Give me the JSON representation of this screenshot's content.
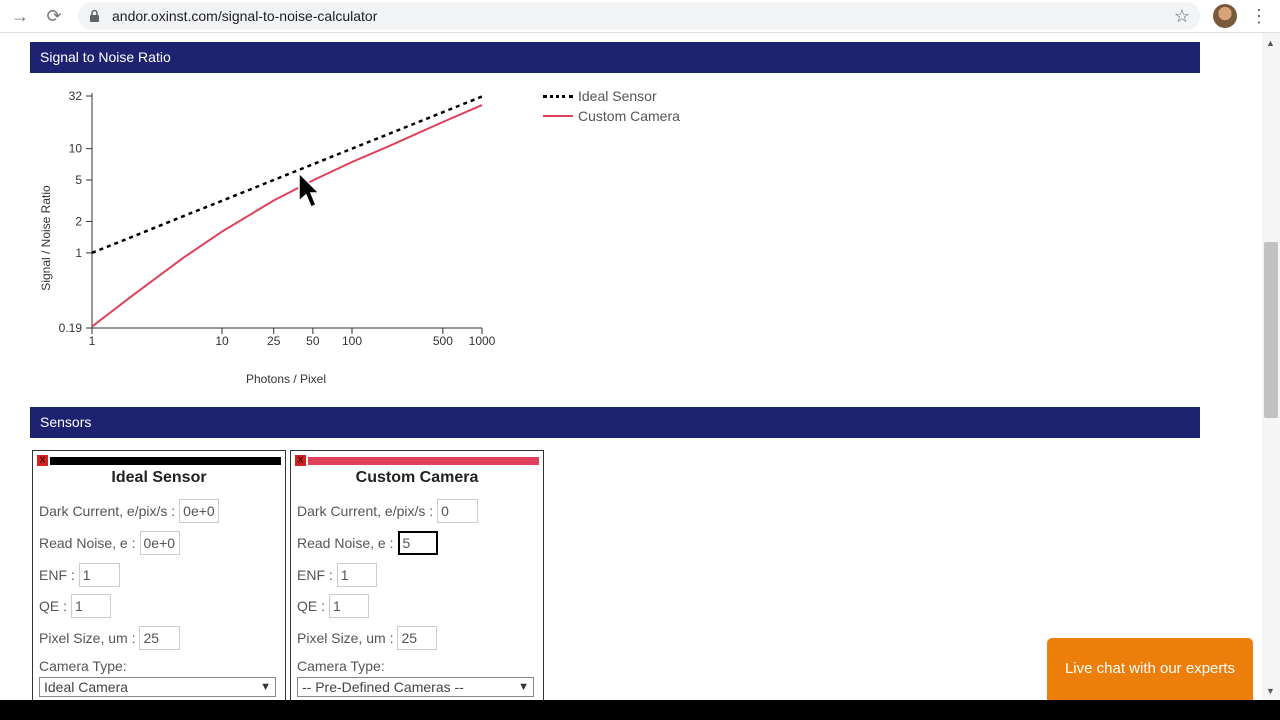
{
  "browser": {
    "url": "andor.oxinst.com/signal-to-noise-calculator",
    "back_icon": "→",
    "reload_icon": "⟳",
    "star_icon": "☆",
    "menu_icon": "⋮"
  },
  "sections": {
    "snr_title": "Signal to Noise Ratio",
    "sensors_title": "Sensors"
  },
  "chart_data": {
    "type": "line",
    "xlabel": "Photons / Pixel",
    "ylabel": "Signal / Noise Ratio",
    "x_scale": "log",
    "y_scale": "log",
    "xlim": [
      1,
      1000
    ],
    "ylim": [
      0.19,
      32
    ],
    "x_ticks": [
      1,
      10,
      25,
      50,
      100,
      500,
      1000
    ],
    "y_ticks": [
      0.19,
      1,
      2,
      5,
      10,
      32
    ],
    "legend_position": "top-right",
    "series": [
      {
        "name": "Ideal Sensor",
        "color": "#000000",
        "style": "dashed",
        "x": [
          1,
          2,
          5,
          10,
          25,
          50,
          100,
          200,
          500,
          1000
        ],
        "y": [
          1,
          1.41,
          2.24,
          3.16,
          5,
          7.07,
          10,
          14.14,
          22.36,
          31.62
        ]
      },
      {
        "name": "Custom Camera",
        "color": "#e0405a",
        "style": "solid",
        "x": [
          1,
          2,
          5,
          10,
          25,
          50,
          100,
          200,
          500,
          1000
        ],
        "y": [
          0.196,
          0.38,
          0.89,
          1.6,
          3.18,
          4.96,
          7.45,
          10.8,
          18.0,
          26.2
        ]
      }
    ]
  },
  "sensors": [
    {
      "title": "Ideal Sensor",
      "bar_color": "#000000",
      "close_label": "X",
      "dark_current_label": "Dark Current, e/pix/s :",
      "dark_current_value": "0e+0",
      "read_noise_label": "Read Noise, e :",
      "read_noise_value": "0e+0",
      "enf_label": "ENF :",
      "enf_value": "1",
      "qe_label": "QE :",
      "qe_value": "1",
      "pixel_size_label": "Pixel Size, um :",
      "pixel_size_value": "25",
      "camera_type_label": "Camera Type:",
      "camera_type_value": "Ideal Camera"
    },
    {
      "title": "Custom Camera",
      "bar_color": "#e0405a",
      "close_label": "X",
      "dark_current_label": "Dark Current, e/pix/s :",
      "dark_current_value": "0",
      "read_noise_label": "Read Noise, e :",
      "read_noise_value": "5",
      "enf_label": "ENF :",
      "enf_value": "1",
      "qe_label": "QE :",
      "qe_value": "1",
      "pixel_size_label": "Pixel Size, um :",
      "pixel_size_value": "25",
      "camera_type_label": "Camera Type:",
      "camera_type_value": "-- Pre-Defined Cameras --"
    }
  ],
  "live_chat": {
    "label": "Live chat with our experts",
    "color": "#ec7f0c"
  },
  "colors": {
    "header_bg": "#1d2371"
  }
}
